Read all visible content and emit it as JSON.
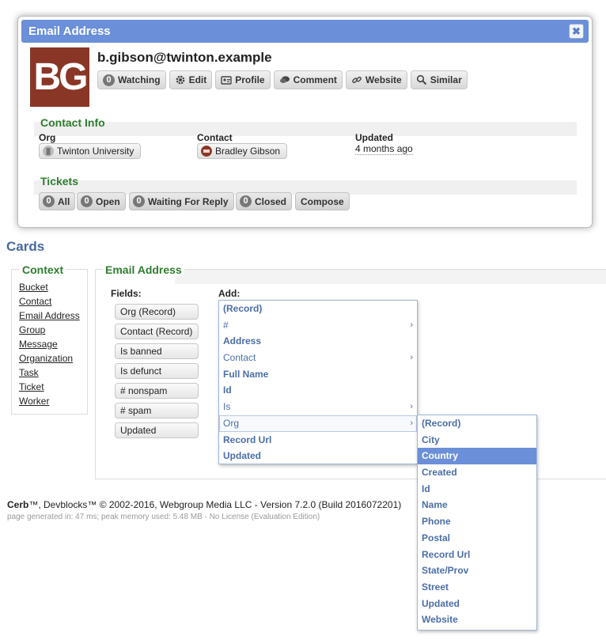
{
  "popup": {
    "title": "Email Address",
    "close_glyph": "✖",
    "avatar_initials": "BG",
    "record_title": "b.gibson@twinton.example",
    "toolbar": {
      "watching": {
        "count": "0",
        "label": "Watching"
      },
      "edit": "Edit",
      "profile": "Profile",
      "comment": "Comment",
      "website": "Website",
      "similar": "Similar"
    },
    "contact_info": {
      "title": "Contact Info",
      "org_label": "Org",
      "org_value": "Twinton University",
      "contact_label": "Contact",
      "contact_value": "Bradley Gibson",
      "updated_label": "Updated",
      "updated_value": "4 months ago"
    },
    "tickets": {
      "title": "Tickets",
      "all": {
        "count": "0",
        "label": "All"
      },
      "open": {
        "count": "0",
        "label": "Open"
      },
      "waiting": {
        "count": "0",
        "label": "Waiting For Reply"
      },
      "closed": {
        "count": "0",
        "label": "Closed"
      },
      "compose": "Compose"
    }
  },
  "cards": {
    "heading": "Cards",
    "context": {
      "title": "Context",
      "items": [
        "Bucket",
        "Contact",
        "Email Address",
        "Group",
        "Message",
        "Organization",
        "Task",
        "Ticket",
        "Worker"
      ]
    },
    "editor": {
      "title": "Email Address",
      "fields_label": "Fields:",
      "add_label": "Add:",
      "fields": [
        "Org (Record)",
        "Contact (Record)",
        "Is banned",
        "Is defunct",
        "# nonspam",
        "# spam",
        "Updated"
      ],
      "add_menu": [
        "(Record)",
        "#",
        "Address",
        "Contact",
        "Full Name",
        "Id",
        "Is",
        "Org",
        "Record Url",
        "Updated"
      ],
      "submenu": [
        "(Record)",
        "City",
        "Country",
        "Created",
        "Id",
        "Name",
        "Phone",
        "Postal",
        "Record Url",
        "State/Prov",
        "Street",
        "Updated",
        "Website"
      ],
      "submenu_selected": "Country"
    }
  },
  "footer": {
    "brand": "Cerb",
    "text": "™, Devblocks™ © 2002-2016, Webgroup Media LLC - Version 7.2.0 (Build 2016072201)",
    "stats": "page generated in: 47 ms; peak memory used: 5.48 MB - No License (Evaluation Edition)"
  },
  "colors": {
    "title_bar": "#6b8fd8",
    "section_title": "#2f7d2f",
    "menu_text": "#4b6ea8",
    "avatar_bg": "#8a3626"
  }
}
